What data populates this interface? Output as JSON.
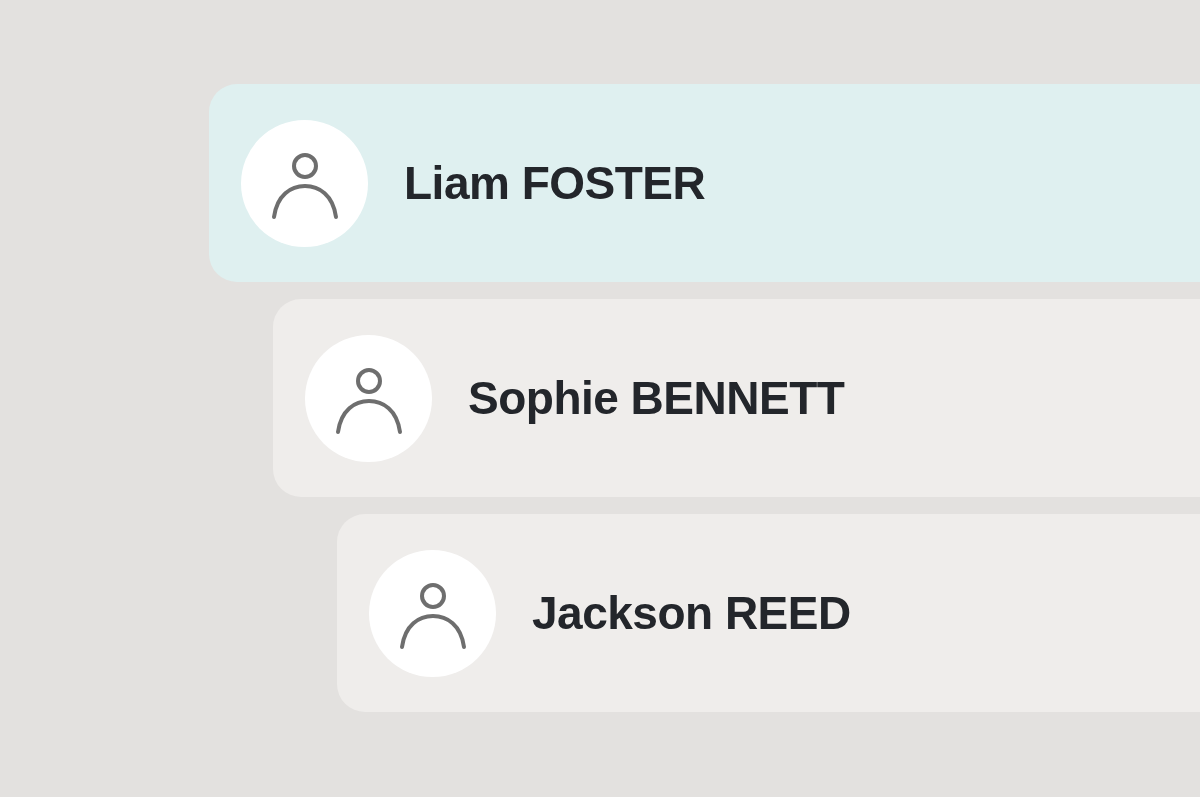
{
  "contacts": [
    {
      "name": "Liam FOSTER",
      "selected": true
    },
    {
      "name": "Sophie BENNETT",
      "selected": false
    },
    {
      "name": "Jackson REED",
      "selected": false
    }
  ]
}
